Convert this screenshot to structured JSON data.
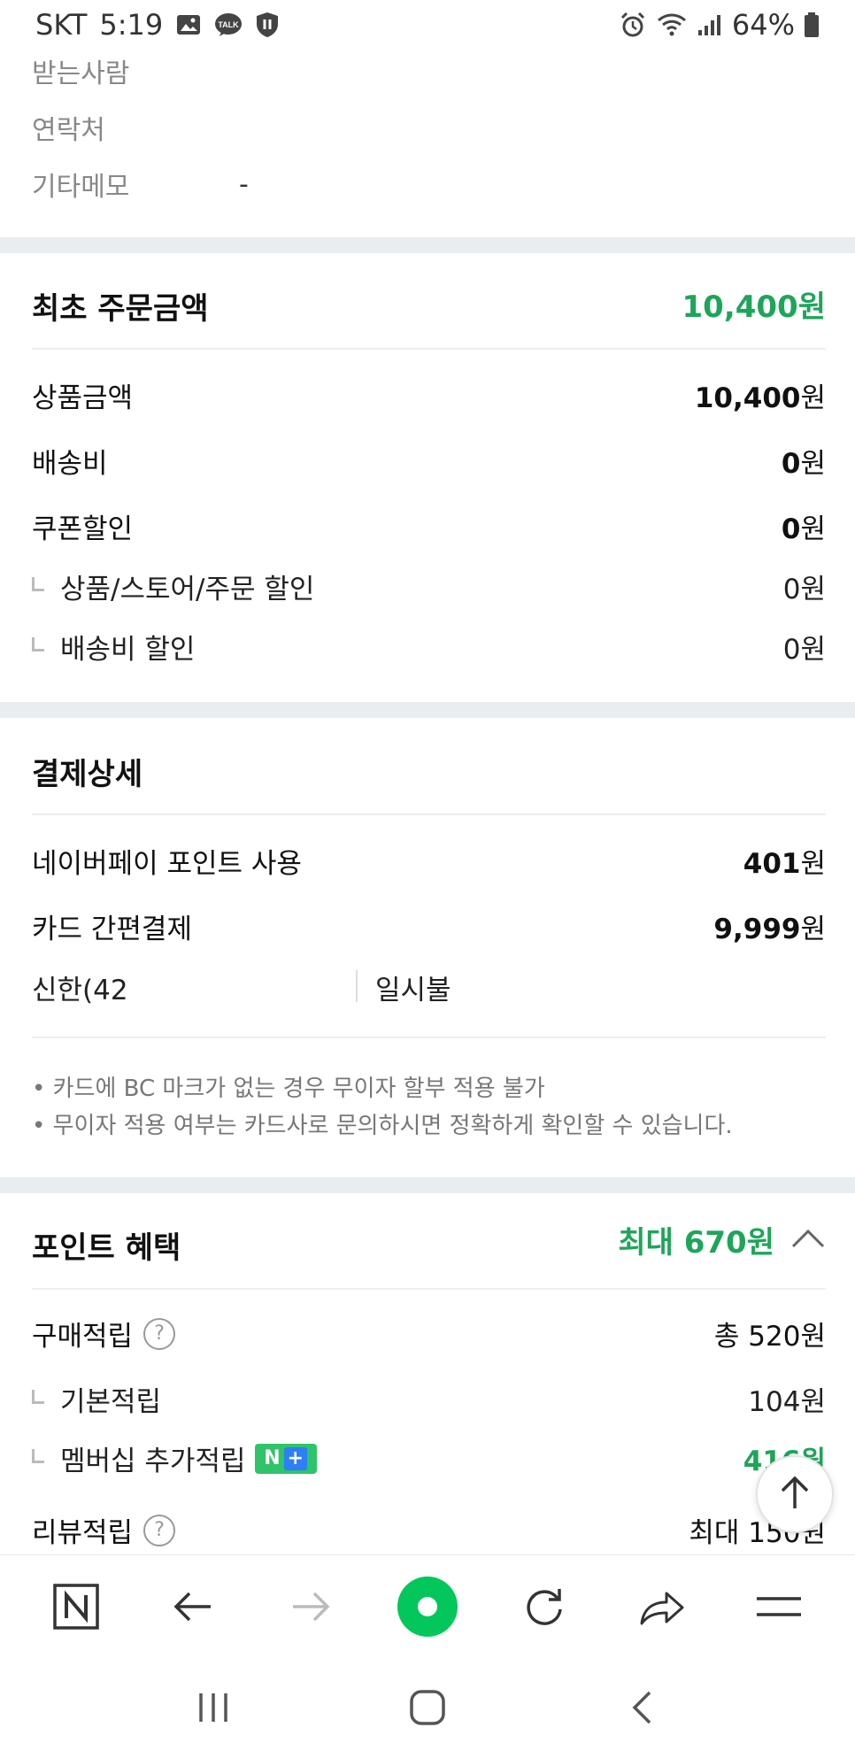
{
  "status_bar": {
    "carrier": "SKT",
    "time": "5:19",
    "battery": "64%"
  },
  "recipient": {
    "receiver_label": "받는사람",
    "contact_label": "연락처",
    "memo_label": "기타메모",
    "memo_value": "-"
  },
  "order_amount": {
    "title": "최초 주문금액",
    "total": "10,400원",
    "rows": [
      {
        "label": "상품금액",
        "amount": "10,400",
        "unit": "원"
      },
      {
        "label": "배송비",
        "amount": "0",
        "unit": "원"
      },
      {
        "label": "쿠폰할인",
        "amount": "0",
        "unit": "원"
      }
    ],
    "sub_rows": [
      {
        "label": "상품/스토어/주문 할인",
        "amount": "0원"
      },
      {
        "label": "배송비 할인",
        "amount": "0원"
      }
    ]
  },
  "payment_detail": {
    "title": "결제상세",
    "rows": [
      {
        "label": "네이버페이 포인트 사용",
        "amount": "401",
        "unit": "원"
      },
      {
        "label": "카드 간편결제",
        "amount": "9,999",
        "unit": "원"
      }
    ],
    "card_name": "신한(42",
    "card_plan": "일시불",
    "notes": [
      "• 카드에 BC 마크가 없는 경우 무이자 할부 적용 불가",
      "• 무이자 적용 여부는 카드사로 문의하시면 정확하게 확인할 수 있습니다."
    ]
  },
  "point_benefit": {
    "title": "포인트 혜택",
    "max_label": "최대 670원",
    "purchase_label": "구매적립",
    "purchase_amount": "총 520원",
    "basic_label": "기본적립",
    "basic_amount": "104원",
    "membership_label": "멤버십 추가적립",
    "membership_amount": "416원",
    "review_label": "리뷰적립",
    "review_amount": "최대 150원",
    "help_glyph": "?",
    "badge_n": "N",
    "badge_plus": "+"
  },
  "colors": {
    "accent_green": "#1ea55a",
    "naver_green": "#03c75a",
    "band_gray": "#e9edf0"
  },
  "icons": {
    "toolbar": [
      "naver-home-icon",
      "back-arrow-icon",
      "forward-arrow-icon",
      "green-dot-icon",
      "refresh-icon",
      "share-icon",
      "menu-icon"
    ],
    "nav": [
      "recent-apps-icon",
      "home-icon",
      "back-icon"
    ]
  }
}
